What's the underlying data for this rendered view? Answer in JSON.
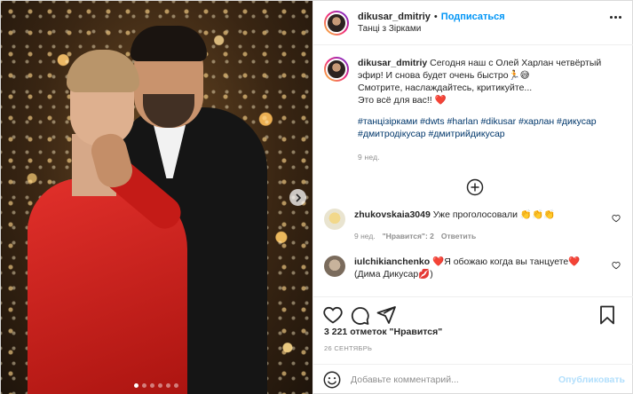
{
  "header": {
    "username": "dikusar_dmitriy",
    "separator": "•",
    "follow_label": "Подписаться",
    "location": "Танці з Зірками"
  },
  "caption": {
    "username": "dikusar_dmitriy",
    "text_line1": "Сегодня наш с Олей Харлан четвёртый эфир! И снова будет очень быстро",
    "text_line1_emoji": "🏃😅",
    "text_line2": "Смотрите, наслаждайтесь, критикуйте...",
    "text_line3": "Это всё для вас!!",
    "text_line3_emoji": "❤️",
    "hashtags_line1": "#танцізірками #dwts #harlan #dikusar #харлан #дикусар",
    "hashtags_line2": "#дмитродікусар #дмитрийдикусар",
    "time": "9 нед."
  },
  "comments": [
    {
      "username": "zhukovskaia3049",
      "text": "Уже проголосовали",
      "emoji": "👏👏👏",
      "time": "9 нед.",
      "likes": "\"Нравится\": 2",
      "reply": "Ответить"
    },
    {
      "username": "iulchikianchenko",
      "text_prefix_emoji": "❤️",
      "text": "Я обожаю когда вы танцуете",
      "text_mid_emoji": "❤️",
      "text_suffix": "(Дима Дикусар",
      "text_suffix_emoji": "💋",
      "text_end": ")"
    }
  ],
  "likes": "3 221 отметок \"Нравится\"",
  "date": "26 СЕНТЯБРЬ",
  "add_comment": {
    "placeholder": "Добавьте комментарий...",
    "publish_label": "Опубликовать"
  },
  "colors": {
    "link": "#0095f6",
    "hashtag": "#00376b",
    "muted": "#8e8e8e",
    "heart": "#ed4956"
  }
}
